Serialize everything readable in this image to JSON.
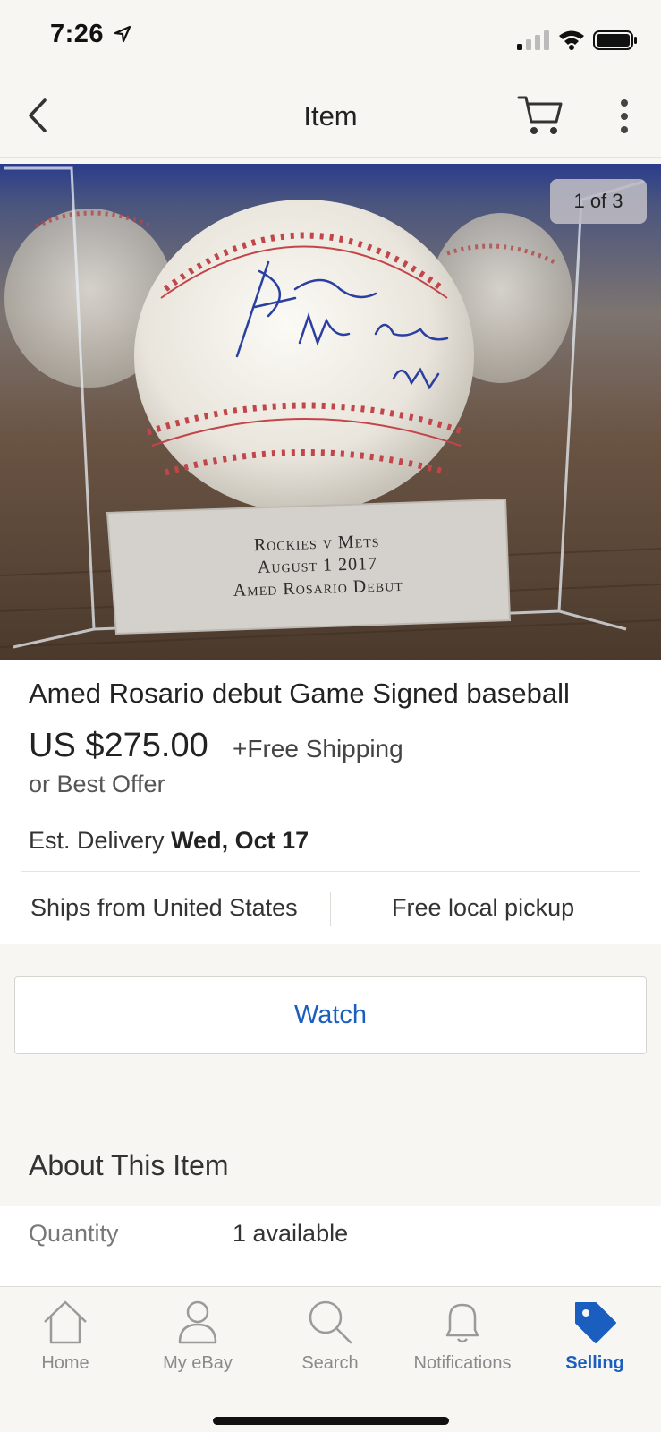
{
  "status_bar": {
    "time": "7:26"
  },
  "nav": {
    "title": "Item"
  },
  "photo": {
    "counter": "1 of 3",
    "signature_text": "Amed MLB Debut 8/1/17",
    "plaque_lines": [
      "Rockies v Mets",
      "August 1 2017",
      "Amed Rosario Debut"
    ]
  },
  "item": {
    "title": "Amed Rosario debut Game Signed baseball",
    "price": "US $275.00",
    "shipping": "+Free Shipping",
    "best_offer": "or Best Offer",
    "delivery_label": "Est. Delivery",
    "delivery_date": "Wed, Oct 17",
    "ships_from": "Ships from United States",
    "pickup": "Free local pickup"
  },
  "actions": {
    "watch_label": "Watch"
  },
  "about": {
    "title": "About This Item",
    "rows": [
      {
        "label": "Quantity",
        "value": "1 available"
      }
    ]
  },
  "tabs": [
    {
      "label": "Home",
      "icon": "home-icon"
    },
    {
      "label": "My eBay",
      "icon": "person-icon"
    },
    {
      "label": "Search",
      "icon": "search-icon"
    },
    {
      "label": "Notifications",
      "icon": "bell-icon"
    },
    {
      "label": "Selling",
      "icon": "tag-icon",
      "active": true
    }
  ],
  "colors": {
    "accent": "#1a5fc0",
    "background": "#f7f6f3"
  }
}
